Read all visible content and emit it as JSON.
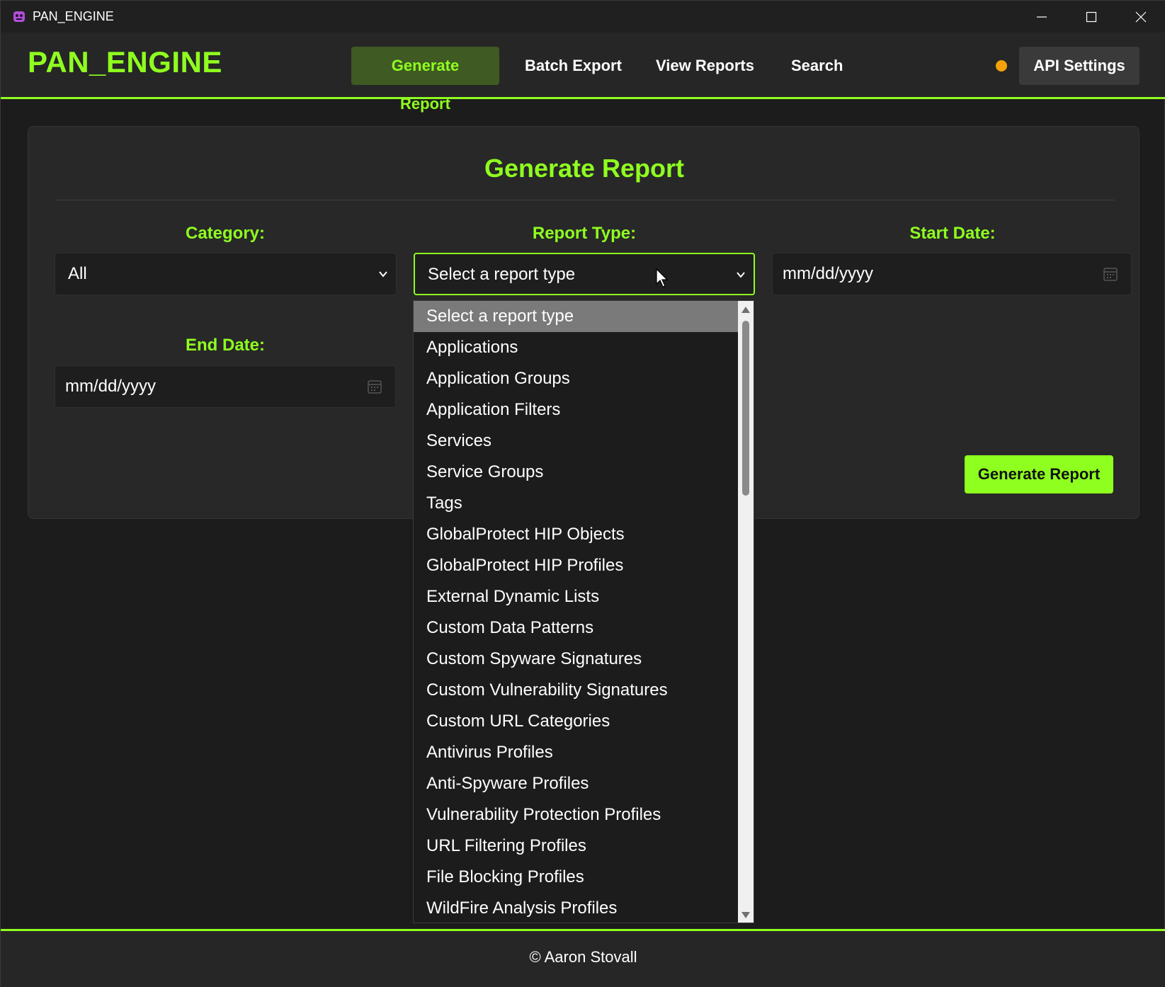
{
  "window": {
    "title": "PAN_ENGINE"
  },
  "header": {
    "logo": "PAN_ENGINE",
    "nav": {
      "generate": "Generate Report",
      "batch": "Batch Export",
      "view": "View Reports",
      "search": "Search"
    },
    "api_settings": "API Settings",
    "status_color": "#f5a20a"
  },
  "form": {
    "title": "Generate Report",
    "category_label": "Category:",
    "category_value": "All",
    "report_type_label": "Report Type:",
    "report_type_value": "Select a report type",
    "start_date_label": "Start Date:",
    "start_date_placeholder": "mm/dd/yyyy",
    "end_date_label": "End Date:",
    "end_date_placeholder": "mm/dd/yyyy",
    "submit": "Generate Report"
  },
  "dropdown": {
    "options": [
      "Select a report type",
      "Applications",
      "Application Groups",
      "Application Filters",
      "Services",
      "Service Groups",
      "Tags",
      "GlobalProtect HIP Objects",
      "GlobalProtect HIP Profiles",
      "External Dynamic Lists",
      "Custom Data Patterns",
      "Custom Spyware Signatures",
      "Custom Vulnerability Signatures",
      "Custom URL Categories",
      "Antivirus Profiles",
      "Anti-Spyware Profiles",
      "Vulnerability Protection Profiles",
      "URL Filtering Profiles",
      "File Blocking Profiles",
      "WildFire Analysis Profiles"
    ],
    "selected_index": 0
  },
  "footer": {
    "text": "© Aaron Stovall"
  },
  "colors": {
    "accent": "#8fff1f",
    "background": "#1c1c1c",
    "panel": "#282828"
  }
}
